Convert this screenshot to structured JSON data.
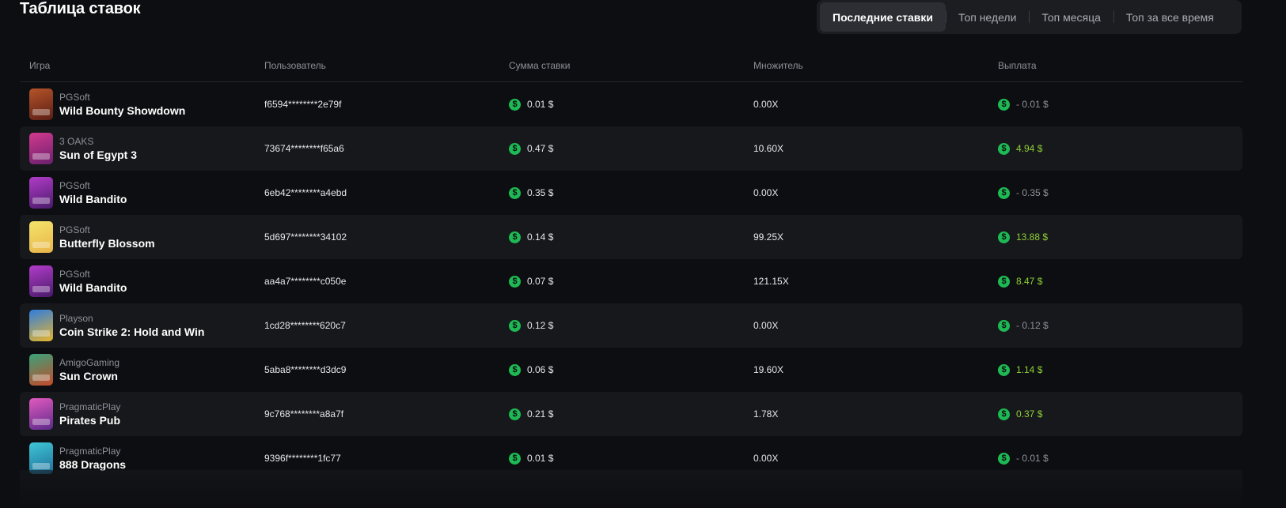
{
  "title": "Таблица ставок",
  "tabs": [
    {
      "label": "Последние ставки",
      "active": true
    },
    {
      "label": "Топ недели",
      "active": false
    },
    {
      "label": "Топ месяца",
      "active": false
    },
    {
      "label": "Топ за все время",
      "active": false
    }
  ],
  "columns": {
    "game": "Игра",
    "user": "Пользователь",
    "sum": "Сумма ставки",
    "mult": "Множитель",
    "pay": "Выплата"
  },
  "currency_icon": "dollar-coin-icon",
  "colors": {
    "positive": "#8fd136",
    "negative": "#8d9097",
    "coin": "#1db954"
  },
  "rows": [
    {
      "provider": "PGSoft",
      "game": "Wild Bounty Showdown",
      "user": "f6594********2e79f",
      "sum": "0.01 $",
      "mult": "0.00X",
      "pay": "- 0.01 $",
      "win": false,
      "thumb": [
        "#b5542a",
        "#5a1d14"
      ]
    },
    {
      "provider": "3 OAKS",
      "game": "Sun of Egypt 3",
      "user": "73674********f65a6",
      "sum": "0.47 $",
      "mult": "10.60X",
      "pay": "4.94 $",
      "win": true,
      "thumb": [
        "#d23a8e",
        "#6a1f6e"
      ]
    },
    {
      "provider": "PGSoft",
      "game": "Wild Bandito",
      "user": "6eb42********a4ebd",
      "sum": "0.35 $",
      "mult": "0.00X",
      "pay": "- 0.35 $",
      "win": false,
      "thumb": [
        "#b13cc9",
        "#4a1a6a"
      ]
    },
    {
      "provider": "PGSoft",
      "game": "Butterfly Blossom",
      "user": "5d697********34102",
      "sum": "0.14 $",
      "mult": "99.25X",
      "pay": "13.88 $",
      "win": true,
      "thumb": [
        "#f3e46a",
        "#e9b44a"
      ]
    },
    {
      "provider": "PGSoft",
      "game": "Wild Bandito",
      "user": "aa4a7********c050e",
      "sum": "0.07 $",
      "mult": "121.15X",
      "pay": "8.47 $",
      "win": true,
      "thumb": [
        "#b13cc9",
        "#4a1a6a"
      ]
    },
    {
      "provider": "Playson",
      "game": "Coin Strike 2: Hold and Win",
      "user": "1cd28********620c7",
      "sum": "0.12 $",
      "mult": "0.00X",
      "pay": "- 0.12 $",
      "win": false,
      "thumb": [
        "#2f7de0",
        "#e6b52c"
      ]
    },
    {
      "provider": "AmigoGaming",
      "game": "Sun Crown",
      "user": "5aba8********d3dc9",
      "sum": "0.06 $",
      "mult": "19.60X",
      "pay": "1.14 $",
      "win": true,
      "thumb": [
        "#3aa37a",
        "#c44a2a"
      ]
    },
    {
      "provider": "PragmaticPlay",
      "game": "Pirates Pub",
      "user": "9c768********a8a7f",
      "sum": "0.21 $",
      "mult": "1.78X",
      "pay": "0.37 $",
      "win": true,
      "thumb": [
        "#e25ac0",
        "#5b2a8a"
      ]
    },
    {
      "provider": "PragmaticPlay",
      "game": "888 Dragons",
      "user": "9396f********1fc77",
      "sum": "0.01 $",
      "mult": "0.00X",
      "pay": "- 0.01 $",
      "win": false,
      "thumb": [
        "#3fc7d6",
        "#1f6e9a"
      ]
    }
  ]
}
